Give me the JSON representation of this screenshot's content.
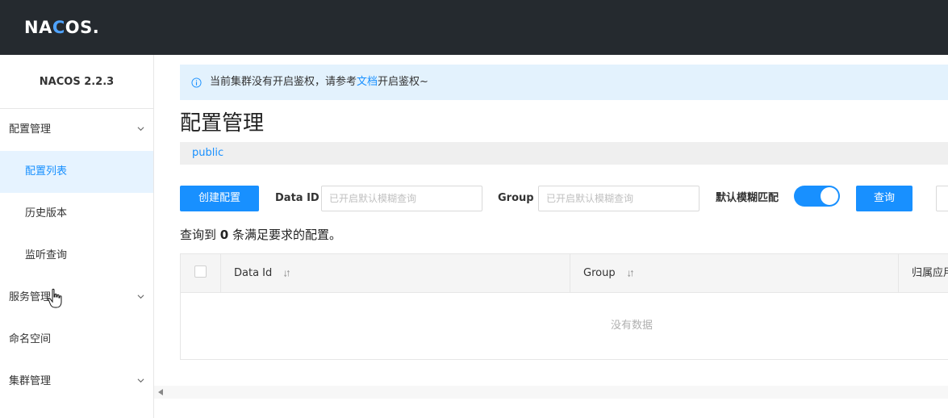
{
  "app": {
    "logo": "NACOS.",
    "version": "NACOS 2.2.3"
  },
  "sidebar": {
    "items": [
      {
        "label": "配置管理",
        "expandable": true
      },
      {
        "label": "配置列表",
        "active": true
      },
      {
        "label": "历史版本"
      },
      {
        "label": "监听查询"
      },
      {
        "label": "服务管理",
        "expandable": true
      },
      {
        "label": "命名空间"
      },
      {
        "label": "集群管理",
        "expandable": true
      }
    ]
  },
  "notice": {
    "text_before": "当前集群没有开启鉴权，请参考",
    "link": "文档",
    "text_after": "开启鉴权~"
  },
  "page": {
    "title": "配置管理",
    "namespace": "public"
  },
  "toolbar": {
    "create_label": "创建配置",
    "dataid_label": "Data ID",
    "dataid_placeholder": "已开启默认模糊查询",
    "group_label": "Group",
    "group_placeholder": "已开启默认模糊查询",
    "fuzzy_label": "默认模糊匹配",
    "fuzzy_on": true,
    "query_label": "查询"
  },
  "result": {
    "prefix": "查询到",
    "count": "0",
    "suffix": "条满足要求的配置。"
  },
  "table": {
    "columns": [
      "Data Id",
      "Group",
      "归属应用"
    ],
    "empty_text": "没有数据"
  },
  "colors": {
    "topbar": "#252a2f",
    "primary": "#1890ff",
    "notice_bg": "#e3f2fd",
    "active_bg": "#e6f3ff"
  }
}
